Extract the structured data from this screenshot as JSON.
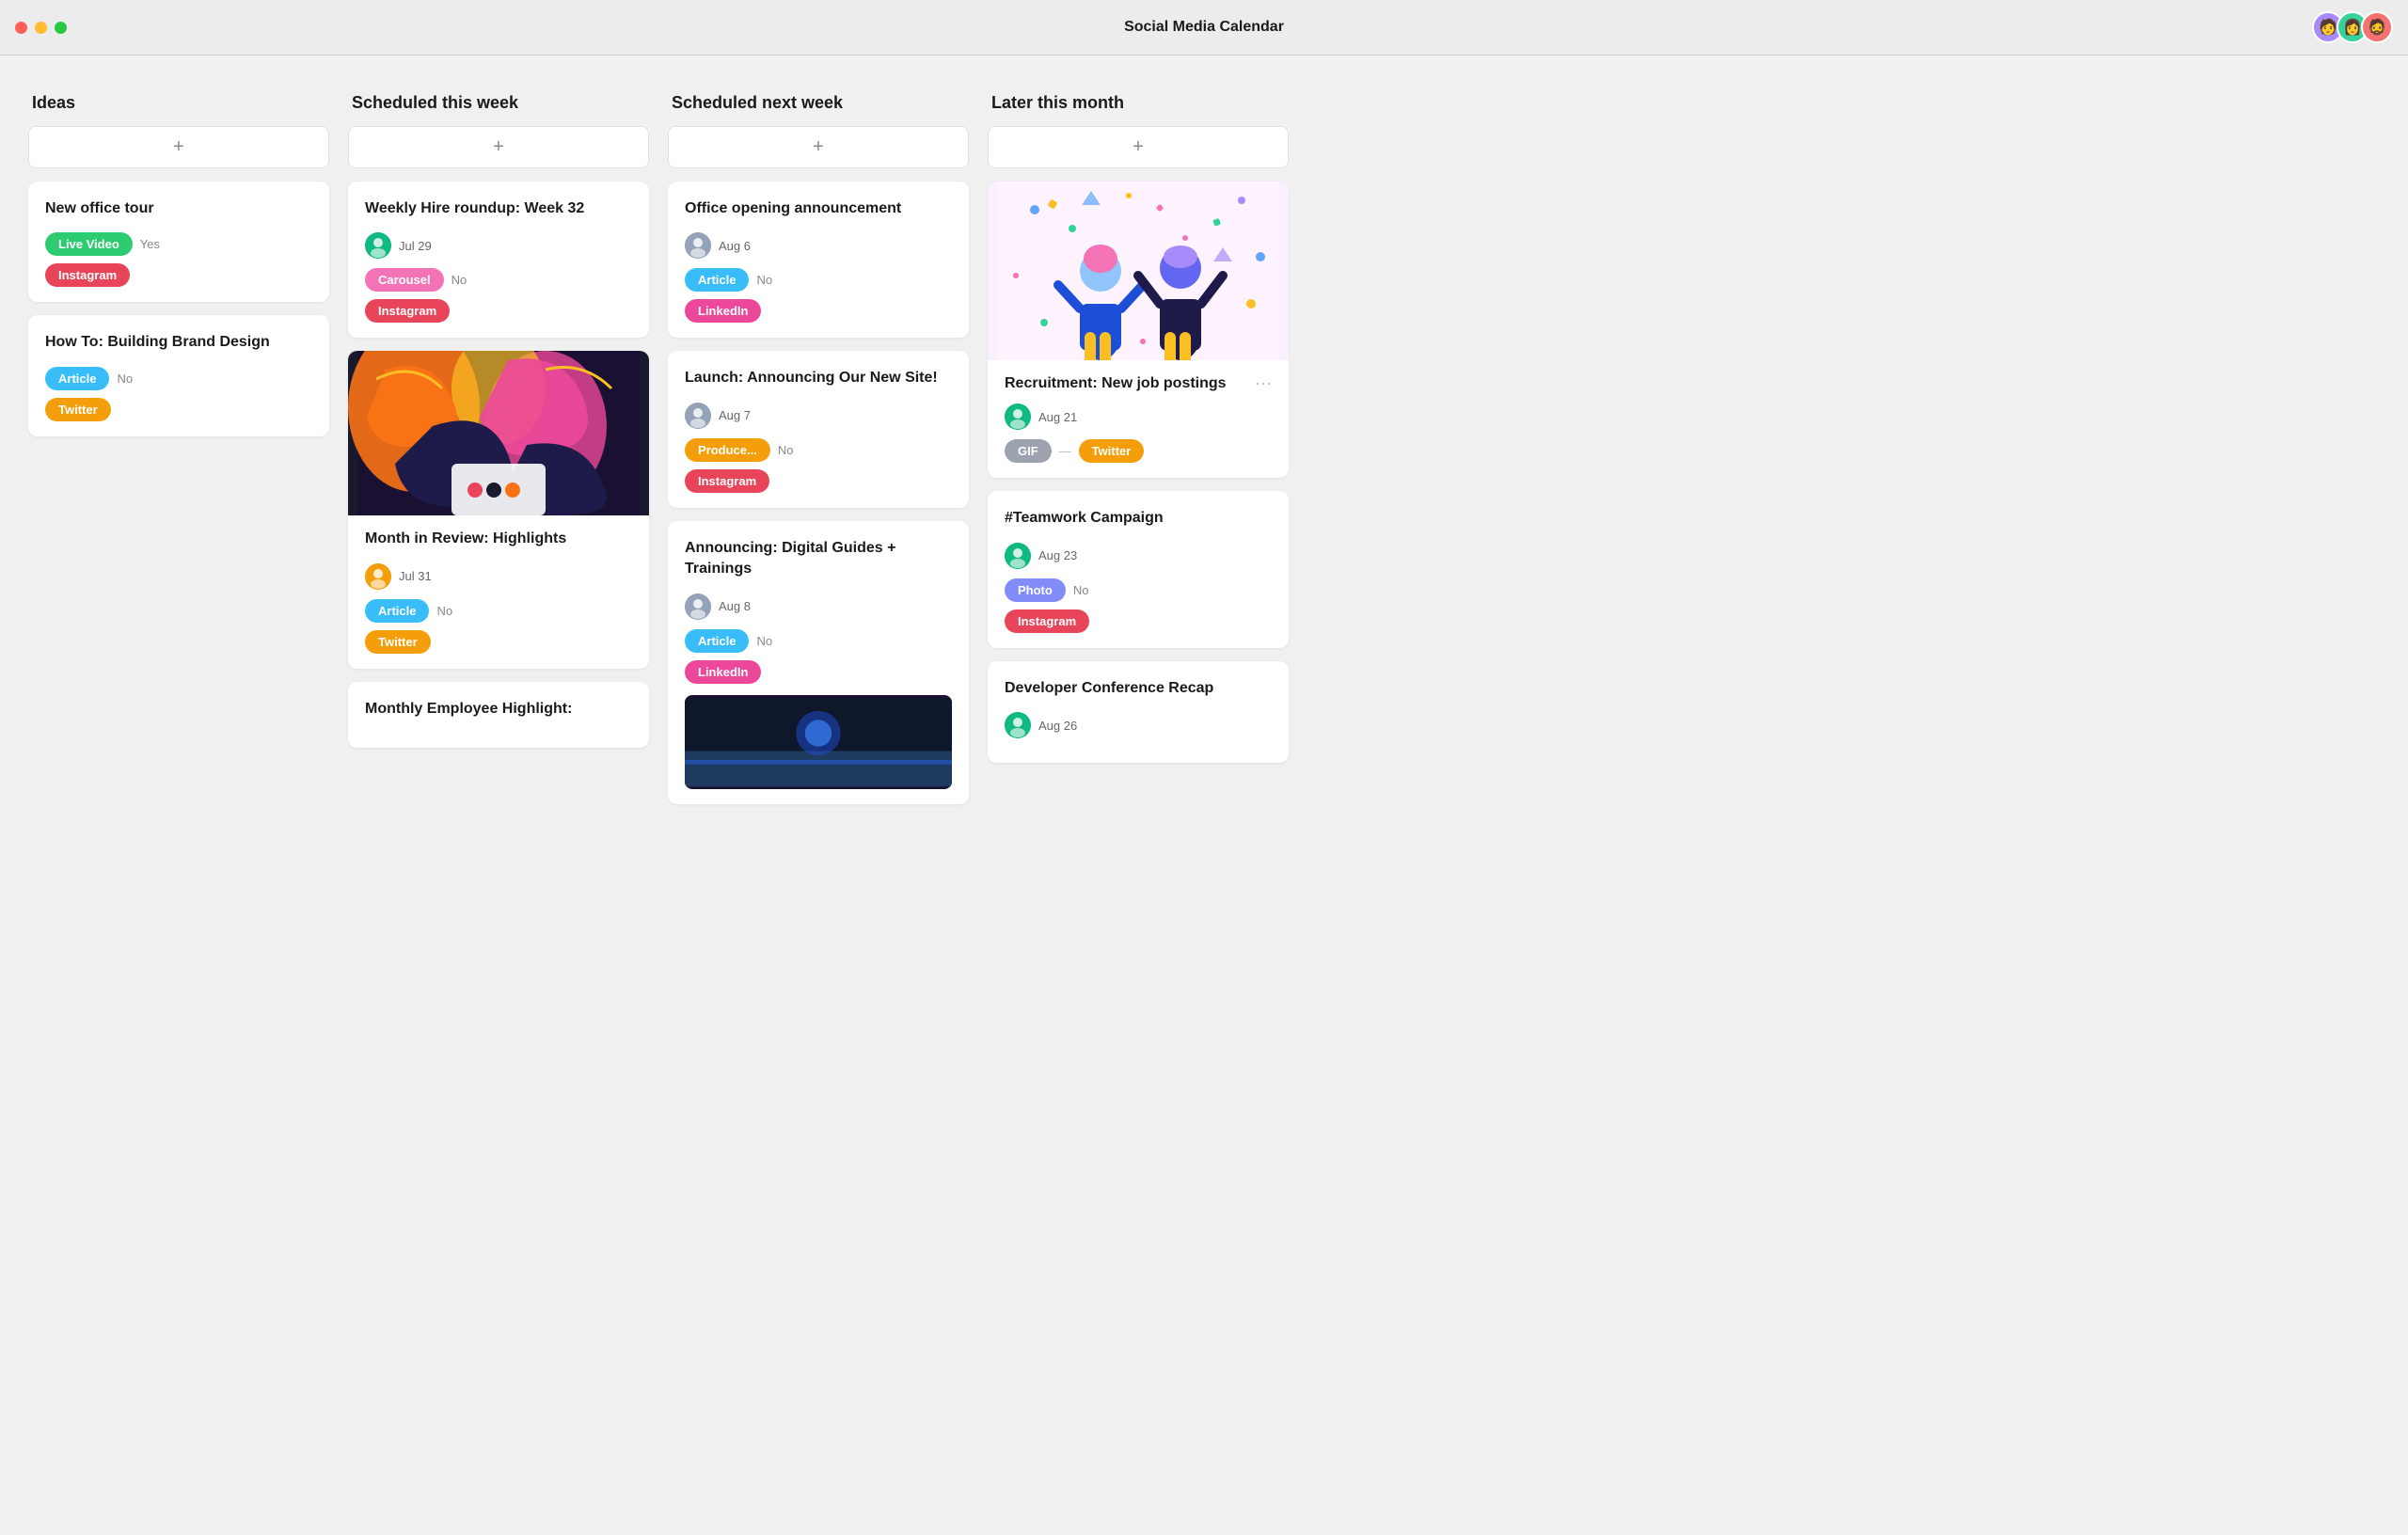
{
  "app": {
    "title": "Social Media Calendar"
  },
  "avatars": [
    "🧑",
    "👩",
    "🧔"
  ],
  "columns": [
    {
      "id": "ideas",
      "header": "Ideas",
      "cards": [
        {
          "id": "new-office-tour",
          "title": "New office tour",
          "avatar_color": "#a3e635",
          "date": null,
          "tags": [
            {
              "label": "Live Video",
              "class": "tag-live-video"
            },
            {
              "label": "Instagram",
              "class": "tag-instagram"
            }
          ],
          "bool_label": "Yes",
          "bool_field": true
        },
        {
          "id": "how-to-brand",
          "title": "How To: Building Brand Design",
          "avatar_color": "#a3e635",
          "date": null,
          "tags": [
            {
              "label": "Article",
              "class": "tag-article"
            },
            {
              "label": "Twitter",
              "class": "tag-twitter"
            }
          ],
          "bool_label": "No",
          "bool_field": false
        }
      ]
    },
    {
      "id": "scheduled-this-week",
      "header": "Scheduled this week",
      "cards": [
        {
          "id": "weekly-hire-roundup",
          "title": "Weekly Hire roundup: Week 32",
          "avatar_color": "#10b981",
          "date": "Jul 29",
          "tags": [
            {
              "label": "Carousel",
              "class": "tag-carousel"
            },
            {
              "label": "Instagram",
              "class": "tag-instagram"
            }
          ],
          "bool_label": "No",
          "bool_field": false,
          "has_image": false
        },
        {
          "id": "month-in-review",
          "title": "Month in Review: Highlights",
          "avatar_color": "#f59e0b",
          "date": "Jul 31",
          "tags": [
            {
              "label": "Article",
              "class": "tag-article"
            },
            {
              "label": "Twitter",
              "class": "tag-twitter"
            }
          ],
          "bool_label": "No",
          "bool_field": false,
          "has_image": true
        },
        {
          "id": "monthly-employee",
          "title": "Monthly Employee Highlight:",
          "avatar_color": "#f59e0b",
          "date": null,
          "tags": [],
          "bool_label": null,
          "bool_field": null,
          "has_image": false,
          "truncated": true
        }
      ]
    },
    {
      "id": "scheduled-next-week",
      "header": "Scheduled next week",
      "cards": [
        {
          "id": "office-opening",
          "title": "Office opening announcement",
          "avatar_color": "#94a3b8",
          "date": "Aug 6",
          "tags": [
            {
              "label": "Article",
              "class": "tag-article"
            },
            {
              "label": "LinkedIn",
              "class": "tag-linkedin"
            }
          ],
          "bool_label": "No",
          "bool_field": false
        },
        {
          "id": "launch-new-site",
          "title": "Launch: Announcing Our New Site!",
          "avatar_color": "#94a3b8",
          "date": "Aug 7",
          "tags": [
            {
              "label": "Produce...",
              "class": "tag-produce"
            },
            {
              "label": "Instagram",
              "class": "tag-instagram"
            }
          ],
          "bool_label": "No",
          "bool_field": false
        },
        {
          "id": "digital-guides",
          "title": "Announcing: Digital Guides + Trainings",
          "avatar_color": "#94a3b8",
          "date": "Aug 8",
          "tags": [
            {
              "label": "Article",
              "class": "tag-article"
            },
            {
              "label": "LinkedIn",
              "class": "tag-linkedin"
            }
          ],
          "bool_label": "No",
          "bool_field": false,
          "has_image_bottom": true
        }
      ]
    },
    {
      "id": "later-this-month",
      "header": "Later this month",
      "cards": [
        {
          "id": "recruitment-job",
          "title": "Recruitment: New job postings",
          "avatar_color": "#10b981",
          "date": "Aug 21",
          "tags": [
            {
              "label": "GIF",
              "class": "tag-gif"
            },
            {
              "label": "Twitter",
              "class": "tag-twitter"
            }
          ],
          "bool_label": null,
          "bool_field": null,
          "has_illustration": true
        },
        {
          "id": "teamwork-campaign",
          "title": "#Teamwork Campaign",
          "avatar_color": "#10b981",
          "date": "Aug 23",
          "tags": [
            {
              "label": "Photo",
              "class": "tag-photo"
            },
            {
              "label": "Instagram",
              "class": "tag-instagram"
            }
          ],
          "bool_label": "No",
          "bool_field": false
        },
        {
          "id": "dev-conference",
          "title": "Developer Conference Recap",
          "avatar_color": "#10b981",
          "date": "Aug 26",
          "tags": [],
          "bool_label": null,
          "bool_field": null,
          "truncated": true
        }
      ]
    }
  ]
}
